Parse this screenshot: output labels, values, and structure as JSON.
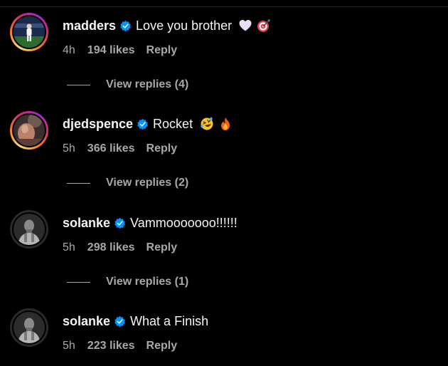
{
  "colors": {
    "background": "#000000",
    "primary_text": "#f5f5f5",
    "secondary_text": "#a8a8a8",
    "verified_badge": "#0095f6"
  },
  "comments": [
    {
      "username": "madders",
      "verified": true,
      "text": "Love you brother",
      "emojis": [
        "white-heart-icon",
        "direct-hit-icon"
      ],
      "time": "4h",
      "likes": "194 likes",
      "reply_label": "Reply",
      "view_replies": "View replies (4)",
      "avatar_ring": "story"
    },
    {
      "username": "djedspence",
      "verified": true,
      "text": "Rocket",
      "emojis": [
        "rolling-laughing-icon",
        "fire-icon"
      ],
      "time": "5h",
      "likes": "366 likes",
      "reply_label": "Reply",
      "view_replies": "View replies (2)",
      "avatar_ring": "story"
    },
    {
      "username": "solanke",
      "verified": true,
      "text": "Vammooooooo!!!!!!",
      "emojis": [],
      "time": "5h",
      "likes": "298 likes",
      "reply_label": "Reply",
      "view_replies": "View replies (1)",
      "avatar_ring": "plain"
    },
    {
      "username": "solanke",
      "verified": true,
      "text": "What a Finish",
      "emojis": [],
      "time": "5h",
      "likes": "223 likes",
      "reply_label": "Reply",
      "avatar_ring": "plain"
    }
  ]
}
